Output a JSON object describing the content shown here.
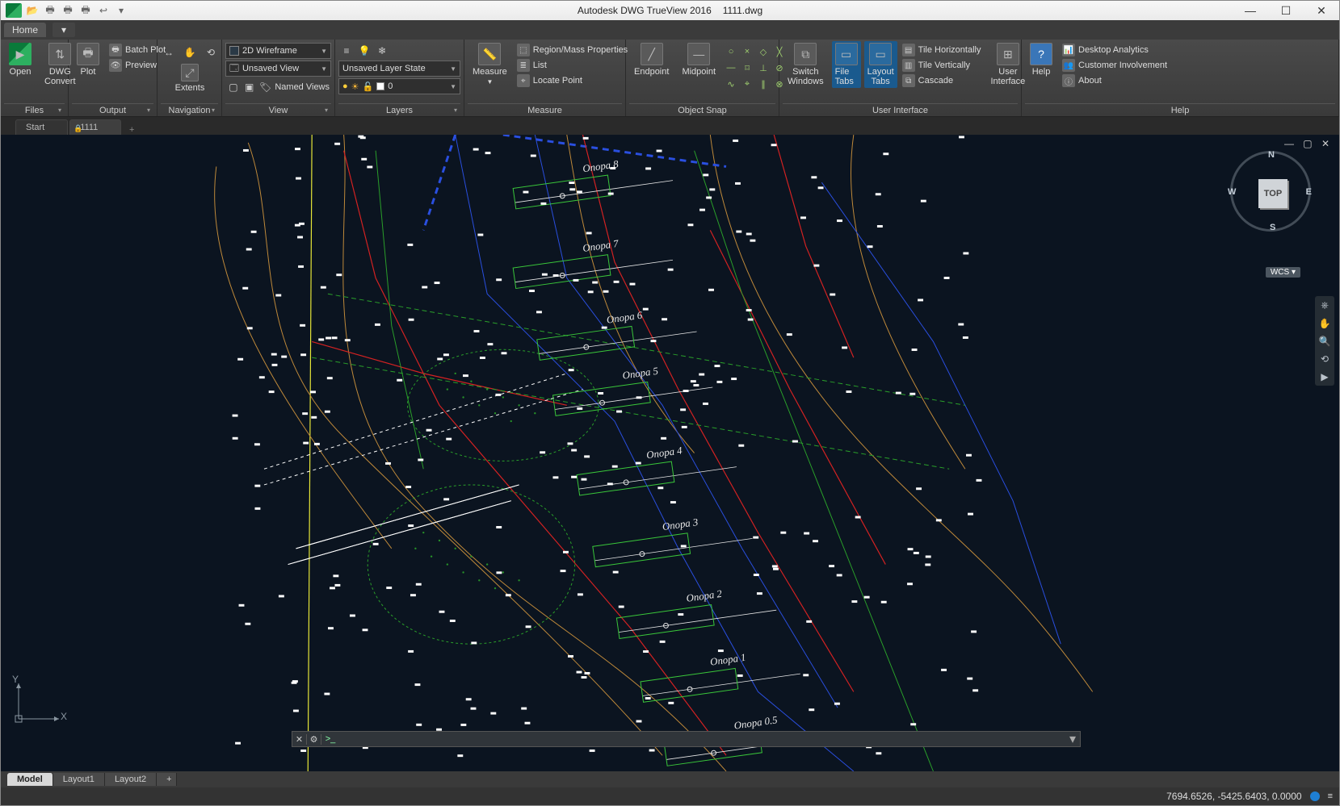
{
  "titlebar": {
    "app": "Autodesk DWG TrueView 2016",
    "doc": "1111.dwg"
  },
  "menubar": {
    "home": "Home"
  },
  "ribbon": {
    "files": {
      "label": "Files",
      "open": "Open",
      "dwgconvert": "DWG\nConvert"
    },
    "output": {
      "label": "Output",
      "plot": "Plot",
      "batch": "Batch Plot",
      "preview": "Preview"
    },
    "navigation": {
      "label": "Navigation",
      "extents": "Extents"
    },
    "view": {
      "label": "View",
      "visualstyle": "2D Wireframe",
      "namedview": "Unsaved View",
      "namedviews": "Named Views"
    },
    "layers": {
      "label": "Layers",
      "layerstate": "Unsaved Layer State",
      "current": "0"
    },
    "measure": {
      "label": "Measure",
      "measure": "Measure",
      "region": "Region/Mass Properties",
      "list": "List",
      "locate": "Locate Point"
    },
    "osnap": {
      "label": "Object Snap",
      "endpoint": "Endpoint",
      "midpoint": "Midpoint"
    },
    "ui": {
      "label": "User Interface",
      "switch": "Switch\nWindows",
      "filetabs": "File Tabs",
      "layouttabs": "Layout\nTabs",
      "tileh": "Tile Horizontally",
      "tilev": "Tile Vertically",
      "cascade": "Cascade",
      "uibtn": "User\nInterface"
    },
    "help": {
      "label": "Help",
      "help": "Help",
      "analytics": "Desktop Analytics",
      "involve": "Customer Involvement",
      "about": "About"
    }
  },
  "filetabs": {
    "start": "Start",
    "doc": "1111"
  },
  "viewcube": {
    "top": "TOP",
    "n": "N",
    "s": "S",
    "e": "E",
    "w": "W",
    "wcs": "WCS"
  },
  "annotations": [
    "Опора 8",
    "Опора 7",
    "Опора 6",
    "Опора 5",
    "Опора 4",
    "Опора 3",
    "Опора 2",
    "Опора 1",
    "Опора 0.5"
  ],
  "ucs": {
    "x": "X",
    "y": "Y"
  },
  "layouts": {
    "model": "Model",
    "l1": "Layout1",
    "l2": "Layout2"
  },
  "status": {
    "coords": "7694.6526, -5425.6403, 0.0000"
  }
}
